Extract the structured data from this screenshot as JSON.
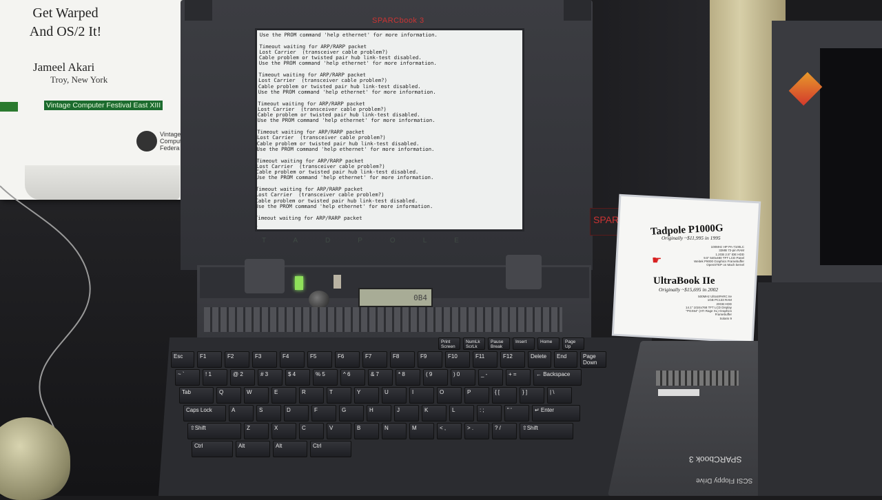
{
  "placard": {
    "title": "Get Warped\nAnd OS/2 It!",
    "name": "Jameel Akari",
    "city": "Troy, New York",
    "event": "Vintage Computer Festival East XIII",
    "org": "Vintage\nComput\nFedera"
  },
  "laptop": {
    "brand": "SPARCbook 3",
    "lid_logo": "TADPOLE",
    "lcd": "0B4",
    "terminal_lines": [
      "Use the PROM command 'help ethernet' for more information.",
      "",
      "Timeout waiting for ARP/RARP packet",
      "Lost Carrier  (transceiver cable problem?)",
      "Cable problem or twisted pair hub link-test disabled.",
      "Use the PROM command 'help ethernet' for more information.",
      "",
      "Timeout waiting for ARP/RARP packet",
      "Lost Carrier  (transceiver cable problem?)",
      "Cable problem or twisted pair hub link-test disabled.",
      "Use the PROM command 'help ethernet' for more information.",
      "",
      "Timeout waiting for ARP/RARP packet",
      "Lost Carrier  (transceiver cable problem?)",
      "Cable problem or twisted pair hub link-test disabled.",
      "Use the PROM command 'help ethernet' for more information.",
      "",
      "Timeout waiting for ARP/RARP packet",
      "Lost Carrier  (transceiver cable problem?)",
      "Cable problem or twisted pair hub link-test disabled.",
      "Use the PROM command 'help ethernet' for more information.",
      "",
      "Timeout waiting for ARP/RARP packet",
      "Lost Carrier  (transceiver cable problem?)",
      "Cable problem or twisted pair hub link-test disabled.",
      "Use the PROM command 'help ethernet' for more information.",
      "",
      "Timeout waiting for ARP/RARP packet",
      "Lost Carrier  (transceiver cable problem?)",
      "Cable problem or twisted pair hub link-test disabled.",
      "Use the PROM command 'help ethernet' for more information.",
      "",
      "Timeout waiting for ARP/RARP packet",
      "_"
    ]
  },
  "keyboard": {
    "rows": [
      [
        "Esc",
        "F1",
        "F2",
        "F3",
        "F4",
        "F5",
        "F6",
        "F7",
        "F8",
        "F9",
        "F10",
        "F11",
        "F12",
        "Delete",
        "End",
        "Page Down"
      ],
      [
        "~ `",
        "! 1",
        "@ 2",
        "# 3",
        "$ 4",
        "% 5",
        "^ 6",
        "& 7",
        "* 8",
        "( 9",
        ") 0",
        "_ -",
        "+ =",
        "← Backspace"
      ],
      [
        "Tab",
        "Q",
        "W",
        "E",
        "R",
        "T",
        "Y",
        "U",
        "I",
        "O",
        "P",
        "{ [",
        "} ]",
        "| \\"
      ],
      [
        "Caps Lock",
        "A",
        "S",
        "D",
        "F",
        "G",
        "H",
        "J",
        "K",
        "L",
        ": ;",
        "\" '",
        "↵ Enter"
      ],
      [
        "⇧Shift",
        "Z",
        "X",
        "C",
        "V",
        "B",
        "N",
        "M",
        "< ,",
        "> .",
        "? /",
        "⇧Shift"
      ],
      [
        "Ctrl",
        "Alt",
        "Alt",
        "Ctrl"
      ]
    ],
    "top_keys": [
      "Print Screen",
      "NumLk ScrLk",
      "Pause Break",
      "Insert",
      "Home",
      "Page Up"
    ]
  },
  "sign": {
    "title1": "Tadpole P1000G",
    "sub1": "Originally ~$11,995 in 1995",
    "specs1": "100MHz HP PA-7100LC\n32MB 72-pin RAM\n1.2GB 2.5\" IDE HDD\n9.5\" 640x480 TFT LCD Panel\nWeitek P9000 Graphics Framebuffer\nOpenSTEP on Mach kernel",
    "title2": "UltraBook IIe",
    "sub2": "Originally ~$15,695 in 2002",
    "specs2": "500MHz UltraSPARC IIe\n1GB PC133 RAM\n20GB HDD\n14.1\" 1024x768 TFT LCD Display\n\"PGX64\" (ATI Rage XL) Graphics Framebuffer\nSolaris 9"
  },
  "floppy": {
    "title": "SPARCbook 3",
    "sub": "SCSI Floppy Drive"
  },
  "red_strip": "SPARCb"
}
